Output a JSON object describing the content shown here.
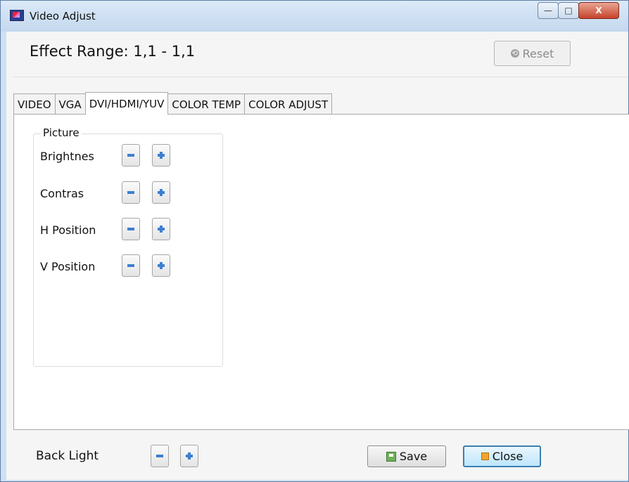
{
  "window": {
    "title": "Video Adjust",
    "controls": {
      "minimize": "—",
      "maximize": "□",
      "close": "X"
    }
  },
  "header": {
    "effect_range": "Effect Range: 1,1 - 1,1",
    "reset_label": "Reset"
  },
  "tabs": [
    {
      "label": "VIDEO",
      "active": false
    },
    {
      "label": "VGA",
      "active": false
    },
    {
      "label": "DVI/HDMI/YUV",
      "active": true
    },
    {
      "label": "COLOR TEMP",
      "active": false
    },
    {
      "label": "COLOR ADJUST",
      "active": false
    }
  ],
  "picture": {
    "title": "Picture",
    "rows": [
      {
        "label": "Brightnes"
      },
      {
        "label": "Contras"
      },
      {
        "label": "H Position"
      },
      {
        "label": "V Position"
      }
    ]
  },
  "footer": {
    "backlight_label": "Back Light",
    "save_label": "Save",
    "close_label": "Close"
  },
  "icons": {
    "minus": "minus-icon",
    "plus": "plus-icon",
    "reset": "reset-icon",
    "save": "save-icon",
    "close": "close-icon"
  },
  "colors": {
    "accent": "#3d7fd0",
    "titlebar": "#c4d8ee",
    "close_button": "#c6432b"
  }
}
